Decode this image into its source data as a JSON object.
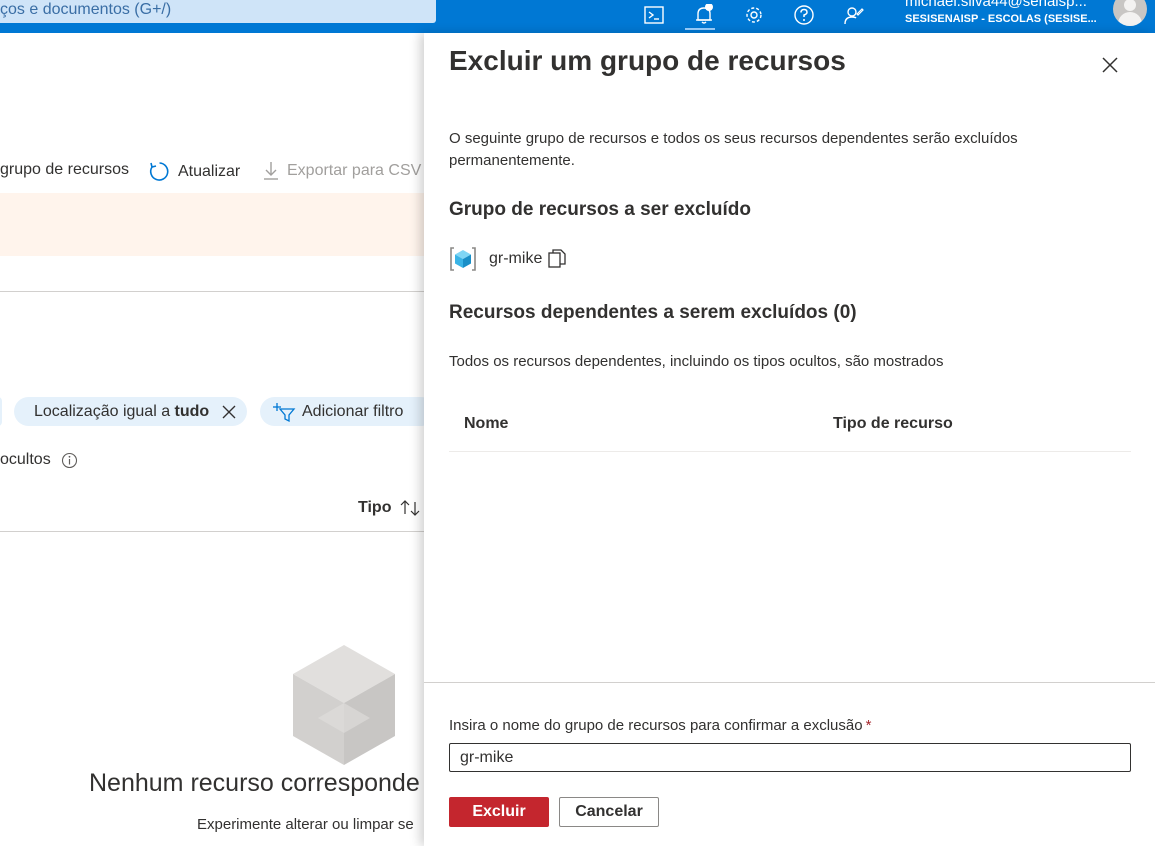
{
  "topbar": {
    "search_placeholder": "ços e documentos (G+/)",
    "user_email": "michael.silva44@senaisp...",
    "user_tenant": "SESISENAISP - ESCOLAS (SESISE..."
  },
  "background_page": {
    "cmd_create_partial": "grupo de recursos",
    "cmd_refresh": "Atualizar",
    "cmd_export": "Exportar para CSV",
    "filter_location_prefix": "Localização igual a ",
    "filter_location_value": "tudo",
    "filter_add": "Adicionar filtro",
    "hidden_types_partial": "ocultos",
    "column_type": "Tipo",
    "empty_title": "Nenhum recurso corresponde",
    "empty_subtitle": "Experimente alterar ou limpar se"
  },
  "panel": {
    "title": "Excluir um grupo de recursos",
    "description": "O seguinte grupo de recursos e todos os seus recursos dependentes serão excluídos permanentemente.",
    "rg_section_title": "Grupo de recursos a ser excluído",
    "rg_name": "gr-mike",
    "dependent_section_title": "Recursos dependentes a serem excluídos (0)",
    "dependent_description": "Todos os recursos dependentes, incluindo os tipos ocultos, são mostrados",
    "table_columns": [
      "Nome",
      "Tipo de recurso"
    ],
    "confirm_label": "Insira o nome do grupo de recursos para confirmar a exclusão",
    "confirm_required_mark": "*",
    "confirm_value": "gr-mike",
    "delete_button": "Excluir",
    "cancel_button": "Cancelar"
  },
  "colors": {
    "topbar": "#0078d4",
    "danger_button": "#c4262e",
    "filter_pill": "#e5f1fb",
    "banner": "#fff4ec"
  }
}
